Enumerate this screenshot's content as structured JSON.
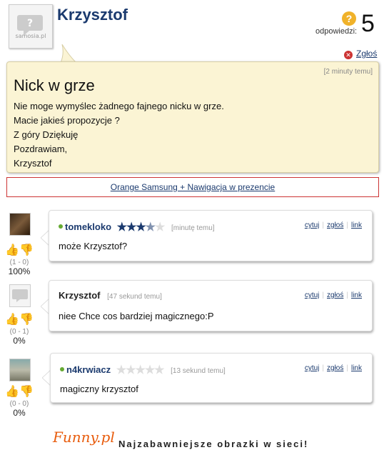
{
  "post": {
    "author": "Krzysztof",
    "avatar_site": "samosia.pl",
    "answers_label": "odpowiedzi:",
    "answers_count": "5",
    "report_label": "Zgłoś",
    "time": "[2 minuty temu]",
    "title": "Nick w grze",
    "body": "Nie moge wymyślec żadnego fajnego nicku w grze.\nMacie jakieś propozycje ?\nZ góry Dziękuję\nPozdrawiam,\nKrzysztof"
  },
  "ad": {
    "label": "Orange Samsung + Nawigacja w prezencie"
  },
  "comments": [
    {
      "user": "tomekloko",
      "online": true,
      "stars_on": 3.5,
      "time": "[minutę temu]",
      "text": "może Krzysztof?",
      "votes": "(1 - 0)",
      "pct": "100%",
      "avatar": "photo"
    },
    {
      "user": "Krzysztof",
      "online": false,
      "stars_on": 0,
      "time": "[47 sekund temu]",
      "text": "niee Chce cos bardziej magicznego:P",
      "votes": "(0 - 1)",
      "pct": "0%",
      "avatar": "samosia"
    },
    {
      "user": "n4krwiacz",
      "online": true,
      "stars_on": 0,
      "time": "[13 sekund temu]",
      "text": "magiczny krzysztof",
      "votes": "(0 - 0)",
      "pct": "0%",
      "avatar": "photo2"
    }
  ],
  "actions": {
    "cite": "cytuj",
    "report": "zgłoś",
    "link": "link"
  },
  "footer": {
    "logo": "Funny.pl",
    "tagline": "Najzabawniejsze obrazki w sieci!"
  },
  "colors": {
    "accent": "#1b3a6e",
    "bubble": "#fbf4d4",
    "report": "#cc3333",
    "online": "#66aa33",
    "brand": "#e85c0d"
  }
}
